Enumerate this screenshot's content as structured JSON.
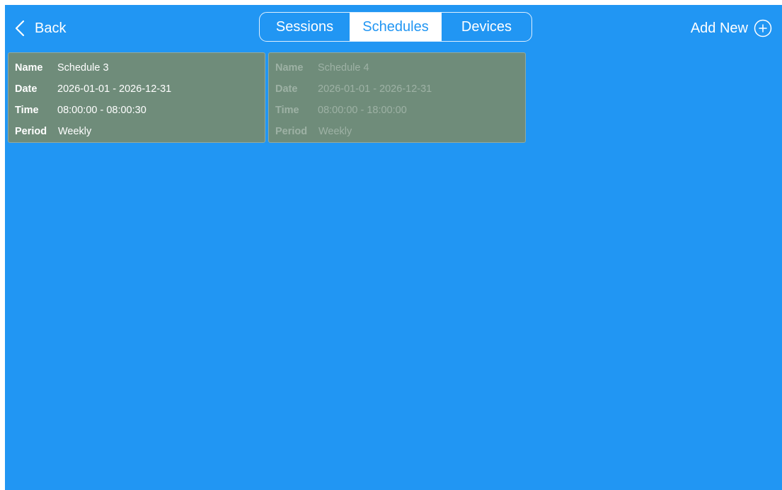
{
  "header": {
    "back_label": "Back",
    "tabs": [
      {
        "label": "Sessions",
        "active": false
      },
      {
        "label": "Schedules",
        "active": true
      },
      {
        "label": "Devices",
        "active": false
      }
    ],
    "add_new_label": "Add New"
  },
  "colors": {
    "background": "#2196f3",
    "card": "#6f8c7a",
    "active_tab_bg": "#ffffff",
    "active_tab_text": "#2196f3"
  },
  "icons": {
    "back": "chevron-left-icon",
    "add": "plus-circle-icon"
  },
  "schedules": [
    {
      "enabled": true,
      "name_label": "Name",
      "name": "Schedule 3",
      "date_label": "Date",
      "date": "2026-01-01 - 2026-12-31",
      "time_label": "Time",
      "time": "08:00:00 - 08:00:30",
      "period_label": "Period",
      "period": "Weekly"
    },
    {
      "enabled": false,
      "name_label": "Name",
      "name": "Schedule 4",
      "date_label": "Date",
      "date": "2026-01-01 - 2026-12-31",
      "time_label": "Time",
      "time": "08:00:00 - 18:00:00",
      "period_label": "Period",
      "period": "Weekly"
    }
  ]
}
